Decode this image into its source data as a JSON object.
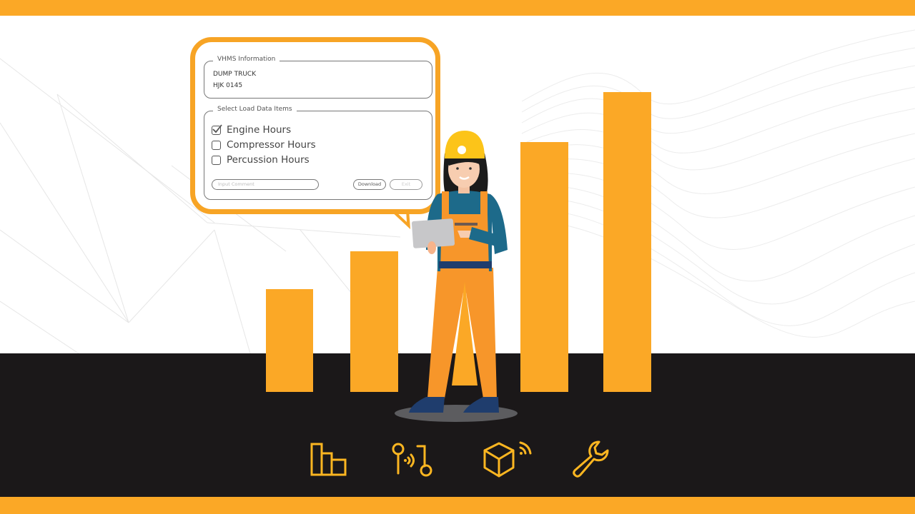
{
  "dialog": {
    "vhms_section": {
      "legend": "VHMS Information",
      "vehicle_type": "DUMP TRUCK",
      "vehicle_id": "HJK 0145"
    },
    "load_section": {
      "legend": "Select Load Data Items",
      "items": [
        {
          "label": "Engine Hours",
          "checked": true
        },
        {
          "label": "Compressor Hours",
          "checked": false
        },
        {
          "label": "Percussion Hours",
          "checked": false
        }
      ]
    },
    "comment_input": {
      "placeholder": "Input Comment",
      "value": ""
    },
    "download_button": "Download",
    "exit_button": "Exit"
  },
  "illustration": {
    "bars_relative_height": [
      0.34,
      0.47,
      0.84,
      1.0
    ],
    "character": "female-worker-with-tablet"
  },
  "footer_icons": [
    {
      "name": "bar-chart-icon"
    },
    {
      "name": "wireless-signal-icon"
    },
    {
      "name": "connected-box-icon"
    },
    {
      "name": "wrench-icon"
    }
  ],
  "colors": {
    "accent": "#fba826",
    "dark": "#1b1819",
    "worker_shirt": "#1d6a8a",
    "worker_overalls": "#f7962a",
    "helmet": "#fcc419",
    "shoes": "#1f3d6d"
  }
}
